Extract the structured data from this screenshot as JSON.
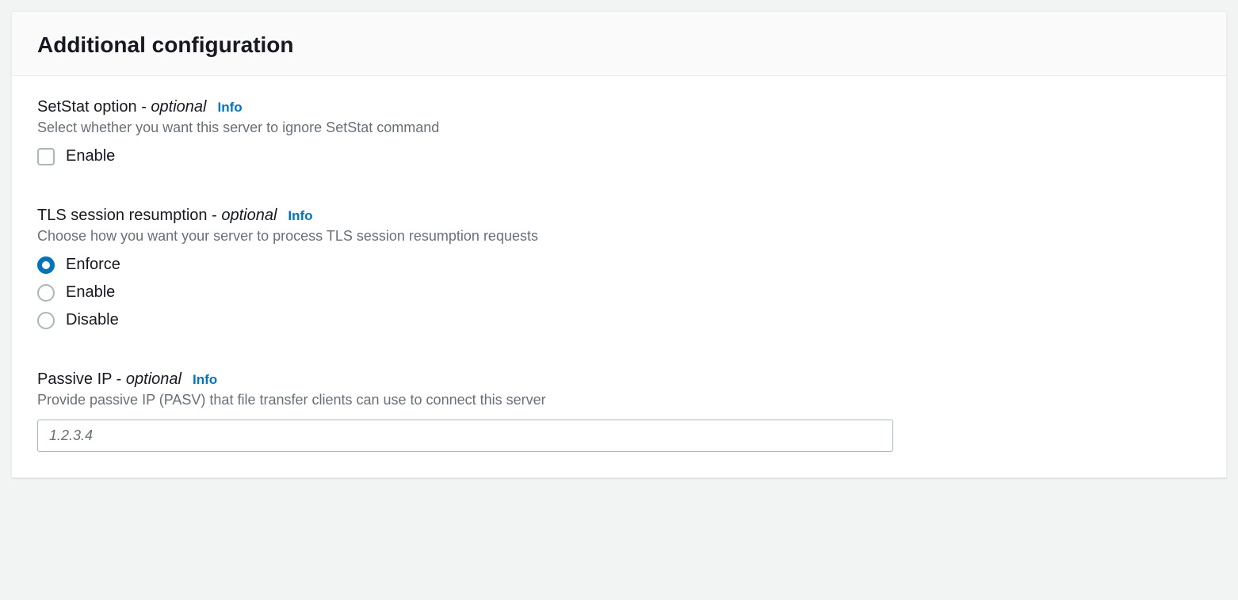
{
  "panel": {
    "title": "Additional configuration"
  },
  "setstat": {
    "title": "SetStat option - ",
    "optional": "optional",
    "info": "Info",
    "desc": "Select whether you want this server to ignore SetStat command",
    "enable_label": "Enable"
  },
  "tls": {
    "title": "TLS session resumption - ",
    "optional": "optional",
    "info": "Info",
    "desc": "Choose how you want your server to process TLS session resumption requests",
    "options": {
      "enforce": "Enforce",
      "enable": "Enable",
      "disable": "Disable"
    }
  },
  "passive": {
    "title": "Passive IP - ",
    "optional": "optional",
    "info": "Info",
    "desc": "Provide passive IP (PASV) that file transfer clients can use to connect this server",
    "placeholder": "1.2.3.4"
  }
}
